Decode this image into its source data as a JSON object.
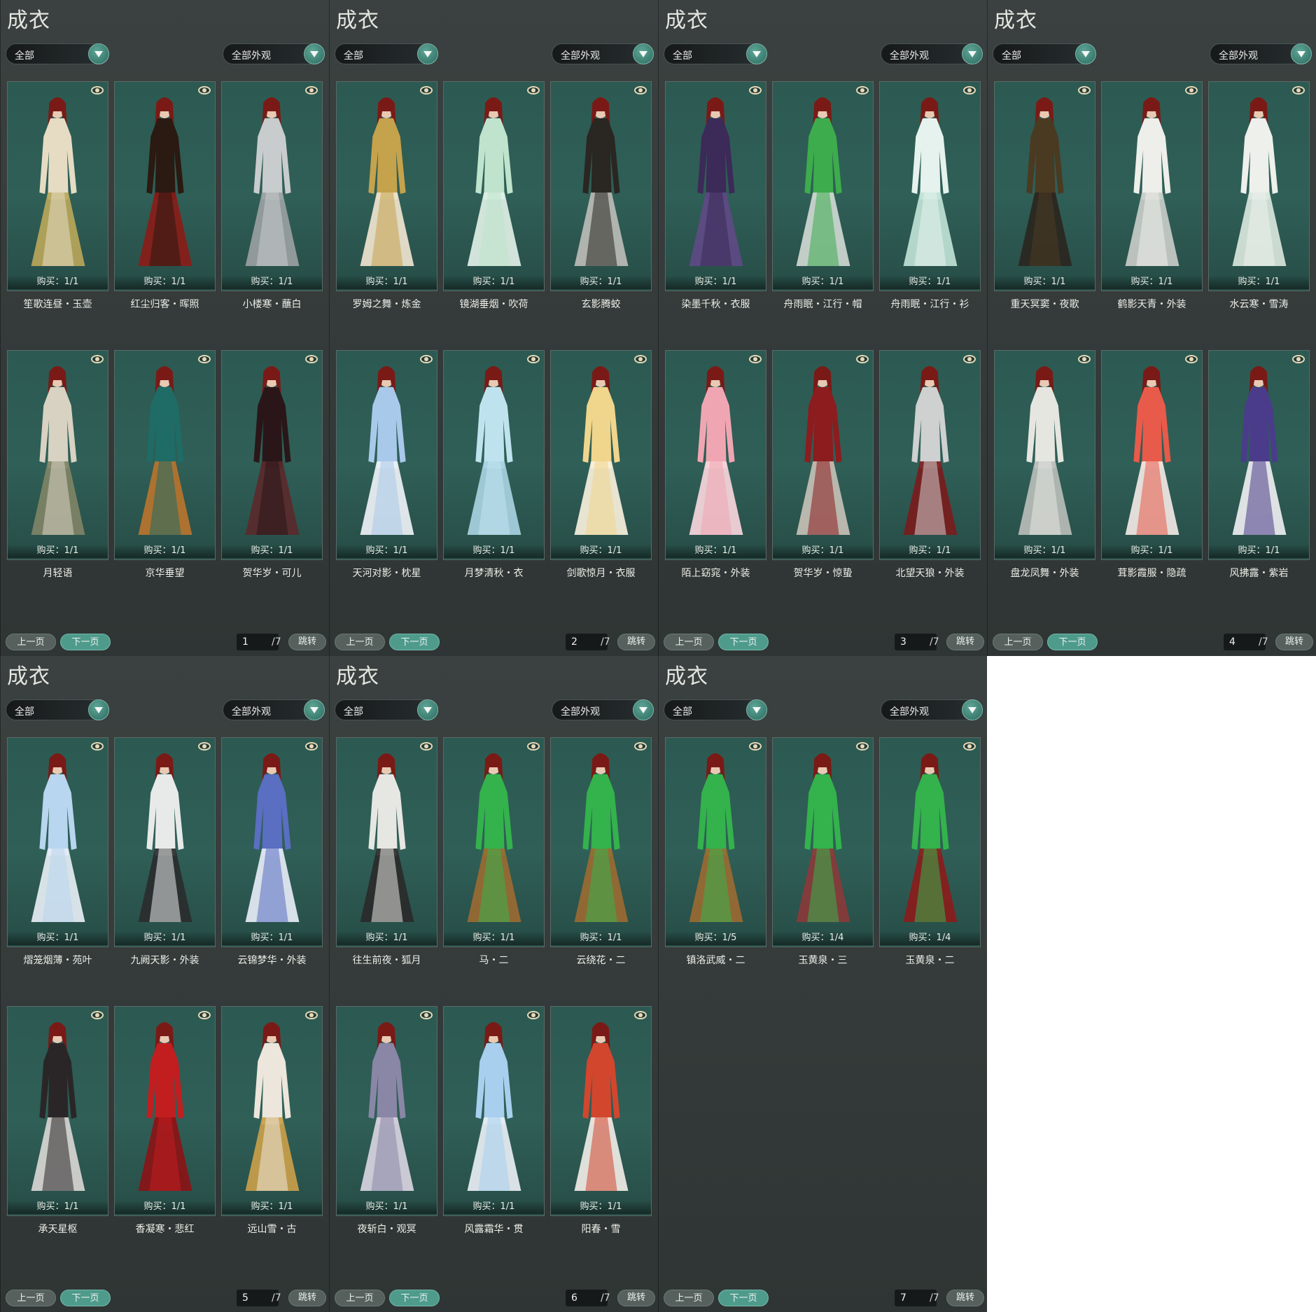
{
  "common": {
    "title": "成衣",
    "filter_category": "全部",
    "filter_appearance": "全部外观",
    "prev_label": "上一页",
    "next_label": "下一页",
    "jump_label": "跳转",
    "total_pages": "/7"
  },
  "panels": [
    {
      "page": "1",
      "items": [
        {
          "name": "笙歌连昼・玉壶",
          "purchase": "购买：1/1",
          "colors": [
            "#e6dcc4",
            "#b9a65a"
          ]
        },
        {
          "name": "红尘归客・晖照",
          "purchase": "购买：1/1",
          "colors": [
            "#2a1a12",
            "#8a1c18"
          ]
        },
        {
          "name": "小楼寒・蘸白",
          "purchase": "购买：1/1",
          "colors": [
            "#c9cccc",
            "#9a9fa2"
          ]
        },
        {
          "name": "月轻语",
          "purchase": "购买：1/1",
          "colors": [
            "#d8d2c2",
            "#7f8366"
          ]
        },
        {
          "name": "京华垂望",
          "purchase": "购买：1/1",
          "colors": [
            "#1f6b66",
            "#b8742e"
          ]
        },
        {
          "name": "贺华岁・可儿",
          "purchase": "购买：1/1",
          "colors": [
            "#2a1618",
            "#5a2a2c"
          ]
        }
      ]
    },
    {
      "page": "2",
      "items": [
        {
          "name": "罗姆之舞・炼金",
          "purchase": "购买：1/1",
          "colors": [
            "#c5a24c",
            "#efe4cf"
          ]
        },
        {
          "name": "镜湖垂烟・吹荷",
          "purchase": "购买：1/1",
          "colors": [
            "#bfe3cc",
            "#dff0e6"
          ]
        },
        {
          "name": "玄影腾蛟",
          "purchase": "购买：1/1",
          "colors": [
            "#2a2622",
            "#bcbcb6"
          ]
        },
        {
          "name": "天河对影・枕星",
          "purchase": "购买：1/1",
          "colors": [
            "#a9c9ea",
            "#eef2f6"
          ]
        },
        {
          "name": "月梦清秋・衣",
          "purchase": "购买：1/1",
          "colors": [
            "#bfe3ee",
            "#a7d1e0"
          ]
        },
        {
          "name": "剑歌惊月・衣服",
          "purchase": "购买：1/1",
          "colors": [
            "#f0d58c",
            "#f7f0dc"
          ]
        }
      ]
    },
    {
      "page": "3",
      "items": [
        {
          "name": "染墨千秋・衣服",
          "purchase": "购买：1/1",
          "colors": [
            "#3c2a58",
            "#5e4a86"
          ]
        },
        {
          "name": "舟雨眠・江行・帽",
          "purchase": "购买：1/1",
          "colors": [
            "#3dac4c",
            "#cfd8d2"
          ]
        },
        {
          "name": "舟雨眠・江行・衫",
          "purchase": "购买：1/1",
          "colors": [
            "#e6f2ee",
            "#bfe2d6"
          ]
        },
        {
          "name": "陌上窈窕・外装",
          "purchase": "购买：1/1",
          "colors": [
            "#f0a6b2",
            "#f7d6dc"
          ]
        },
        {
          "name": "贺华岁・惊蛰",
          "purchase": "购买：1/1",
          "colors": [
            "#8c1c1e",
            "#c6c0b6"
          ]
        },
        {
          "name": "北望天狼・外装",
          "purchase": "购买：1/1",
          "colors": [
            "#cfd0d0",
            "#7a1c1c"
          ]
        }
      ]
    },
    {
      "page": "4",
      "items": [
        {
          "name": "重天冥窦・夜歌",
          "purchase": "购买：1/1",
          "colors": [
            "#4a3a22",
            "#2a2620"
          ]
        },
        {
          "name": "鹤影天青・外装",
          "purchase": "购买：1/1",
          "colors": [
            "#eeeeea",
            "#c8ccc8"
          ]
        },
        {
          "name": "水云寒・雪涛",
          "purchase": "购买：1/1",
          "colors": [
            "#eef0ec",
            "#d8e6dc"
          ]
        },
        {
          "name": "盘龙凤舞・外装",
          "purchase": "购买：1/1",
          "colors": [
            "#e6e6e0",
            "#b8bdb8"
          ]
        },
        {
          "name": "茸影霞服・隐疏",
          "purchase": "购买：1/1",
          "colors": [
            "#e85a4a",
            "#f2e8e4"
          ]
        },
        {
          "name": "风拂露・紫岩",
          "purchase": "购买：1/1",
          "colors": [
            "#4a3c8a",
            "#eeeef0"
          ]
        }
      ]
    },
    {
      "page": "5",
      "items": [
        {
          "name": "熠笼烟薄・苑叶",
          "purchase": "购买：1/1",
          "colors": [
            "#b8d6ef",
            "#e6eef4"
          ]
        },
        {
          "name": "九阙天影・外装",
          "purchase": "购买：1/1",
          "colors": [
            "#e8eaea",
            "#2a2c2e"
          ]
        },
        {
          "name": "云锦梦华・外装",
          "purchase": "购买：1/1",
          "colors": [
            "#5a6ec2",
            "#e6ecf6"
          ]
        },
        {
          "name": "承天星枢",
          "purchase": "购买：1/1",
          "colors": [
            "#2a2628",
            "#d8d6d2"
          ]
        },
        {
          "name": "香凝寒・悲红",
          "purchase": "购买：1/1",
          "colors": [
            "#c21e20",
            "#8a1416"
          ]
        },
        {
          "name": "远山雪・古",
          "purchase": "购买：1/1",
          "colors": [
            "#ece6dc",
            "#c9a04a"
          ]
        }
      ]
    },
    {
      "page": "6",
      "items": [
        {
          "name": "往生前夜・狐月",
          "purchase": "购买：1/1",
          "colors": [
            "#e6e6e2",
            "#2a2a2a"
          ]
        },
        {
          "name": "马・二",
          "purchase": "购买：1/1",
          "colors": [
            "#34b24c",
            "#9a6a32"
          ]
        },
        {
          "name": "云绕花・二",
          "purchase": "购买：1/1",
          "colors": [
            "#34b24c",
            "#9a6a32"
          ]
        },
        {
          "name": "夜斩白・观冥",
          "purchase": "购买：1/1",
          "colors": [
            "#8a86a6",
            "#d8d4e0"
          ]
        },
        {
          "name": "风露霜华・贯",
          "purchase": "购买：1/1",
          "colors": [
            "#a8cfee",
            "#e8eef4"
          ]
        },
        {
          "name": "阳春・雪",
          "purchase": "购买：1/1",
          "colors": [
            "#d2462e",
            "#f0ece6"
          ]
        }
      ]
    },
    {
      "page": "7",
      "items": [
        {
          "name": "镇洛武威・二",
          "purchase": "购买：1/5",
          "colors": [
            "#34b24c",
            "#9a6a32"
          ]
        },
        {
          "name": "玉黄泉・三",
          "purchase": "购买：1/4",
          "colors": [
            "#34b24c",
            "#8a3a3a"
          ]
        },
        {
          "name": "玉黄泉・二",
          "purchase": "购买：1/4",
          "colors": [
            "#34b24c",
            "#8a1c1c"
          ]
        }
      ]
    }
  ]
}
